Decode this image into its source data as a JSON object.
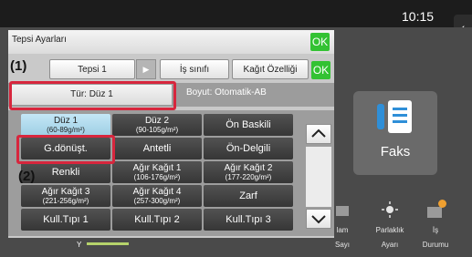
{
  "status": {
    "time": "10:15",
    "side_tab_glyph": "‹"
  },
  "home": {
    "fax_label": "Faks",
    "bottom_items": [
      {
        "line1": "lam",
        "line2": "Sayı"
      },
      {
        "line1": "Parlaklık",
        "line2": "Ayarı"
      },
      {
        "line1": "İş",
        "line2": "Durumu"
      }
    ],
    "slider_label": "Y",
    "colors": {
      "accent_green": "#33c233",
      "highlight_red": "#d7263d",
      "selected_blue": "#b3ddef"
    }
  },
  "dialog": {
    "title": "Tepsi Ayarları",
    "ok_label": "OK",
    "tabs": [
      "Tepsi 1",
      "İş sınıfı",
      "Kağıt Özelliği"
    ],
    "tab_arrow_glyph": "▶",
    "paper_type": "Tür: Düz 1",
    "size": "Boyut:  Otomatik-AB",
    "callouts": {
      "one": "(1)",
      "two": "(2)"
    },
    "grid": [
      {
        "line1": "Düz 1",
        "line2": "(60-89g/m²)",
        "selected": true
      },
      {
        "line1": "Düz 2",
        "line2": "(90-105g/m²)"
      },
      {
        "line1": "Ön Baskili",
        "line2": ""
      },
      {
        "line1": "G.dönüşt.",
        "line2": ""
      },
      {
        "line1": "Antetli",
        "line2": ""
      },
      {
        "line1": "Ön-Delgili",
        "line2": ""
      },
      {
        "line1": "Renkli",
        "line2": ""
      },
      {
        "line1": "Ağır Kağıt 1",
        "line2": "(106-176g/m²)"
      },
      {
        "line1": "Ağır Kağıt 2",
        "line2": "(177-220g/m²)"
      },
      {
        "line1": "Ağır Kağıt 3",
        "line2": "(221-256g/m²)"
      },
      {
        "line1": "Ağır Kağıt 4",
        "line2": "(257-300g/m²)"
      },
      {
        "line1": "Zarf",
        "line2": ""
      },
      {
        "line1": "Kull.Tıpı 1",
        "line2": ""
      },
      {
        "line1": "Kull.Tıpı 2",
        "line2": ""
      },
      {
        "line1": "Kull.Tıpı 3",
        "line2": ""
      }
    ],
    "scroll_up_glyph": "︿",
    "scroll_down_glyph": "﹀"
  }
}
